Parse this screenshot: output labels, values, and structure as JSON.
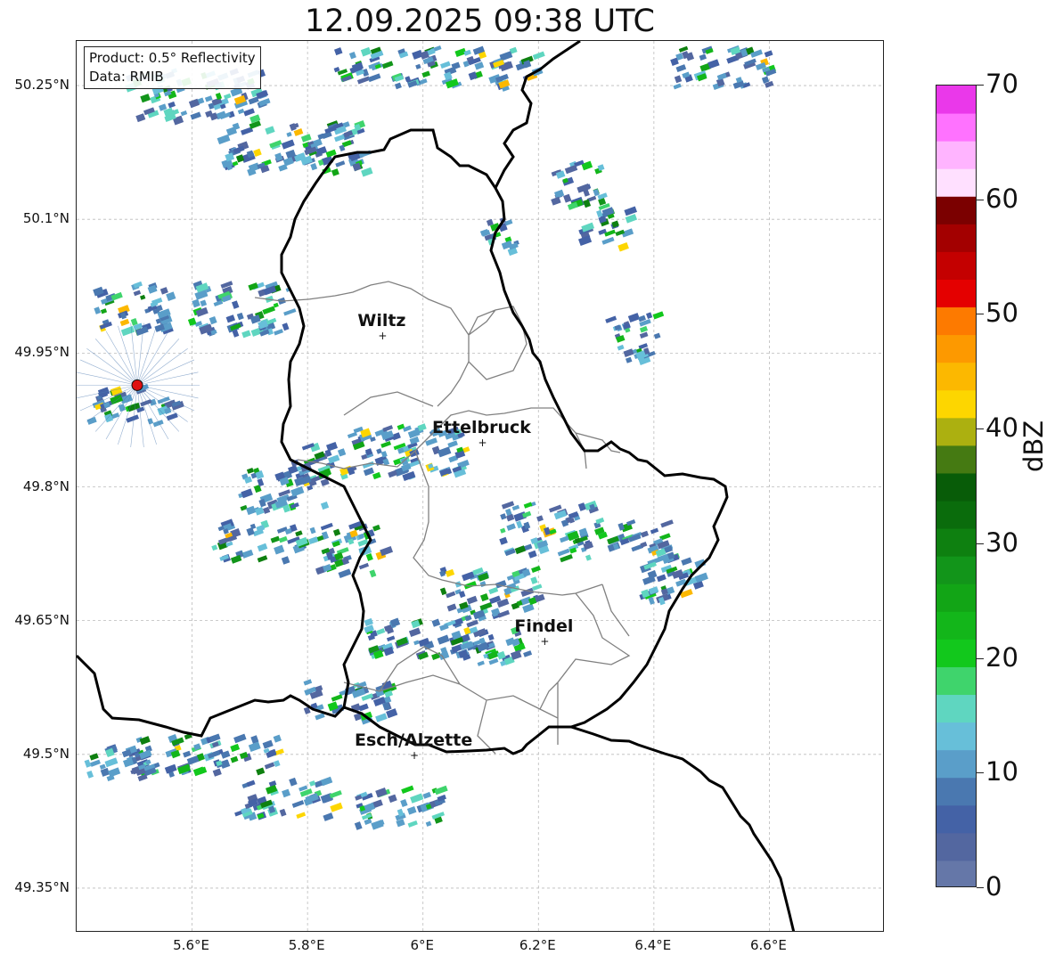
{
  "title": "12.09.2025 09:38 UTC",
  "info": {
    "product": "Product: 0.5° Reflectivity",
    "data": "Data: RMIB"
  },
  "map": {
    "lon_range": [
      5.4,
      6.8
    ],
    "lat_range": [
      49.3,
      50.3
    ],
    "lat_ticks": [
      {
        "value": 50.25,
        "label": "50.25°N"
      },
      {
        "value": 50.1,
        "label": "50.1°N"
      },
      {
        "value": 49.95,
        "label": "49.95°N"
      },
      {
        "value": 49.8,
        "label": "49.8°N"
      },
      {
        "value": 49.65,
        "label": "49.65°N"
      },
      {
        "value": 49.5,
        "label": "49.5°N"
      },
      {
        "value": 49.35,
        "label": "49.35°N"
      }
    ],
    "lon_ticks": [
      {
        "value": 5.6,
        "label": "5.6°E"
      },
      {
        "value": 5.8,
        "label": "5.8°E"
      },
      {
        "value": 6.0,
        "label": "6°E"
      },
      {
        "value": 6.2,
        "label": "6.2°E"
      },
      {
        "value": 6.4,
        "label": "6.4°E"
      },
      {
        "value": 6.6,
        "label": "6.6°E"
      }
    ],
    "cities": [
      {
        "name": "Wiltz",
        "lon": 5.93,
        "lat": 49.968
      },
      {
        "name": "Ettelbruck",
        "lon": 6.103,
        "lat": 49.848
      },
      {
        "name": "Findel",
        "lon": 6.211,
        "lat": 49.626
      },
      {
        "name": "Esch/Alzette",
        "lon": 5.985,
        "lat": 49.498
      }
    ],
    "radar_site": {
      "lon": 5.505,
      "lat": 49.914,
      "color": "#e01010"
    },
    "grid": true
  },
  "colorbar": {
    "label": "dBZ",
    "ticks": [
      {
        "value": 0,
        "label": "0"
      },
      {
        "value": 10,
        "label": "10"
      },
      {
        "value": 20,
        "label": "20"
      },
      {
        "value": 30,
        "label": "30"
      },
      {
        "value": 40,
        "label": "40"
      },
      {
        "value": 50,
        "label": "50"
      },
      {
        "value": 60,
        "label": "60"
      },
      {
        "value": 70,
        "label": "70"
      }
    ],
    "range": [
      0,
      70
    ],
    "colors": [
      "#6577a8",
      "#5367a0",
      "#4462a6",
      "#4a78b0",
      "#5a9ec9",
      "#67bfd9",
      "#5fd6c0",
      "#3fd46c",
      "#12c81c",
      "#13b61a",
      "#12a516",
      "#12951a",
      "#0e8010",
      "#0a6c0c",
      "#085c08",
      "#457a12",
      "#acb010",
      "#fdd600",
      "#fcb800",
      "#fd9900",
      "#fd7a00",
      "#e40000",
      "#c40000",
      "#a30000",
      "#7b0000",
      "#ffe0ff",
      "#ffb4ff",
      "#ff72ff",
      "#ea38ea"
    ]
  }
}
